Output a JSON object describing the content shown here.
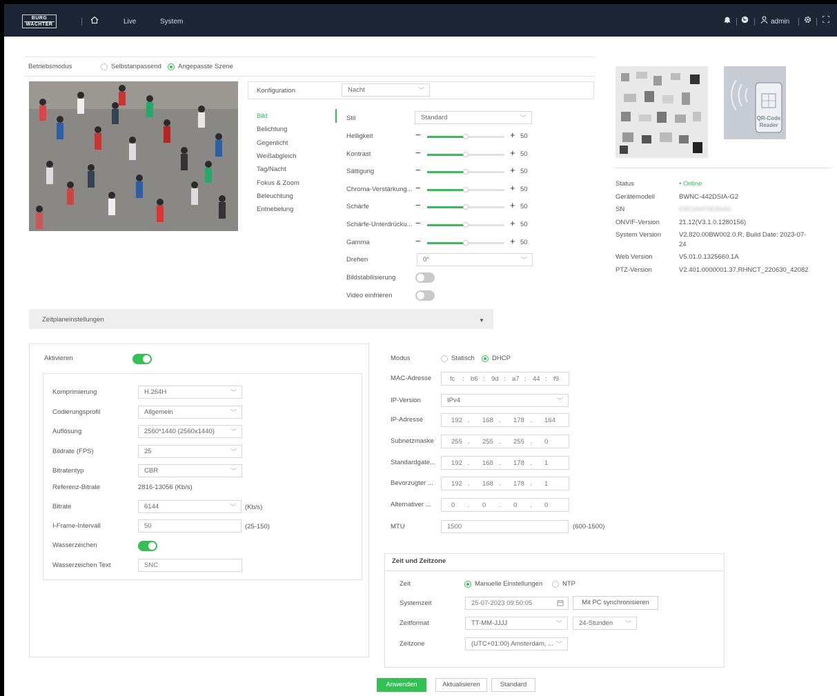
{
  "header": {
    "logo_line1": "BURG",
    "logo_line2": "WACHTER",
    "nav_live": "Live",
    "nav_system": "System",
    "user": "admin"
  },
  "mode": {
    "label": "Betriebsmodus",
    "option1": "Selbstanpassend",
    "option2": "Angepasste Szene",
    "selected": "Angepasste Szene"
  },
  "config": {
    "label": "Konfiguration",
    "value": "Nacht"
  },
  "menu": [
    "Bild",
    "Belichtung",
    "Gegenlicht",
    "Weißabgleich",
    "Tag/Nacht",
    "Fokus & Zoom",
    "Beleuchtung",
    "Entnebelung"
  ],
  "image_settings": {
    "stil_label": "Stil",
    "stil_value": "Standard",
    "sliders": [
      {
        "label": "Helligkeit",
        "value": "50",
        "level": 0.5
      },
      {
        "label": "Kontrast",
        "value": "50",
        "level": 0.5
      },
      {
        "label": "Sättigung",
        "value": "50",
        "level": 0.5
      },
      {
        "label": "Chroma-Verstärkung...",
        "value": "50",
        "level": 0.5
      },
      {
        "label": "Schärfe",
        "value": "50",
        "level": 0.5
      },
      {
        "label": "Schärfe-Unterdrücku...",
        "value": "50",
        "level": 0.5
      },
      {
        "label": "Gamma",
        "value": "50",
        "level": 0.5
      }
    ],
    "drehen_label": "Drehen",
    "drehen_value": "0°",
    "stab_label": "Bildstabilisierung",
    "freeze_label": "Video einfrieren"
  },
  "device": {
    "qr_label_1": "QR-Code",
    "qr_label_2": "Reader",
    "status_label": "Status",
    "status_value": "• Online",
    "model_label": "Gerätemodell",
    "model_value": "BWNC-442DSIA-G2",
    "sn_label": "SN",
    "sn_value": "E8E5A6F8EB6A0",
    "onvif_label": "ONVIF-Version",
    "onvif_value": "21.12(V3.1.0.1280156)",
    "sys_label": "System Version",
    "sys_value_1": "V2.820.00BW002.0.R, Build Date: 2023-07-",
    "sys_value_2": "24",
    "web_label": "Web Version",
    "web_value": "V5.01.0.1325660.1A",
    "ptz_label": "PTZ-Version",
    "ptz_value": "V2.401.0000001.37.RHNCT_220630_42082"
  },
  "schedule": {
    "label": "Zeitplaneinstellungen"
  },
  "encode": {
    "aktivieren": "Aktivieren",
    "rows": [
      {
        "label": "Komprimierung",
        "value": "H.264H",
        "type": "select"
      },
      {
        "label": "Codierungsprofil",
        "value": "Allgemein",
        "type": "select"
      },
      {
        "label": "Auflösung",
        "value": "2560*1440 (2560x1440)",
        "type": "select"
      },
      {
        "label": "Bildrate (FPS)",
        "value": "25",
        "type": "select"
      },
      {
        "label": "Bitratentyp",
        "value": "CBR",
        "type": "select"
      }
    ],
    "ref_label": "Referenz-Bitrate",
    "ref_value": "2816-13056 (Kb/s)",
    "bitrate_label": "Bitrate",
    "bitrate_value": "6144",
    "bitrate_unit": "(Kb/s)",
    "iframe_label": "I-Frame-Intervall",
    "iframe_value": "50",
    "iframe_range": "(25-150)",
    "wm_label": "Wasserzeichen",
    "wmtext_label": "Wasserzeichen Text",
    "wmtext_value": "SNC"
  },
  "network": {
    "modus_label": "Modus",
    "statisch": "Statisch",
    "dhcp": "DHCP",
    "mac_label": "MAC-Adresse",
    "mac": [
      "fc",
      "b6",
      "9d",
      "a7",
      "44",
      "f9"
    ],
    "ipver_label": "IP-Version",
    "ipver_value": "IPv4",
    "ip_label": "IP-Adresse",
    "ip": [
      "192",
      "168",
      "178",
      "164"
    ],
    "subnet_label": "Subnetzmaske",
    "subnet": [
      "255",
      "255",
      "255",
      "0"
    ],
    "gw_label": "Standardgate...",
    "gw": [
      "192",
      "168",
      "178",
      "1"
    ],
    "dns1_label": "Bevorzugter ...",
    "dns1": [
      "192",
      "168",
      "178",
      "1"
    ],
    "dns2_label": "Alternativer ...",
    "dns2": [
      "0",
      "0",
      "0",
      "0"
    ],
    "mtu_label": "MTU",
    "mtu_value": "1500",
    "mtu_range": "(600-1500)"
  },
  "time": {
    "title": "Zeit und Zeitzone",
    "zeit_label": "Zeit",
    "manual": "Manuelle Einstellungen",
    "ntp": "NTP",
    "sys_label": "Systemzeit",
    "sys_value": "25-07-2023 09:50:05",
    "sync_btn": "Mit PC synchronisieren",
    "fmt_label": "Zeitformat",
    "fmt_value": "TT-MM-JJJJ",
    "hours_value": "24-Stunden",
    "zone_label": "Zeitzone",
    "zone_value": "(UTC+01:00) Amsterdam, ..."
  },
  "actions": {
    "apply": "Anwenden",
    "refresh": "Aktualisieren",
    "default": "Standard"
  }
}
